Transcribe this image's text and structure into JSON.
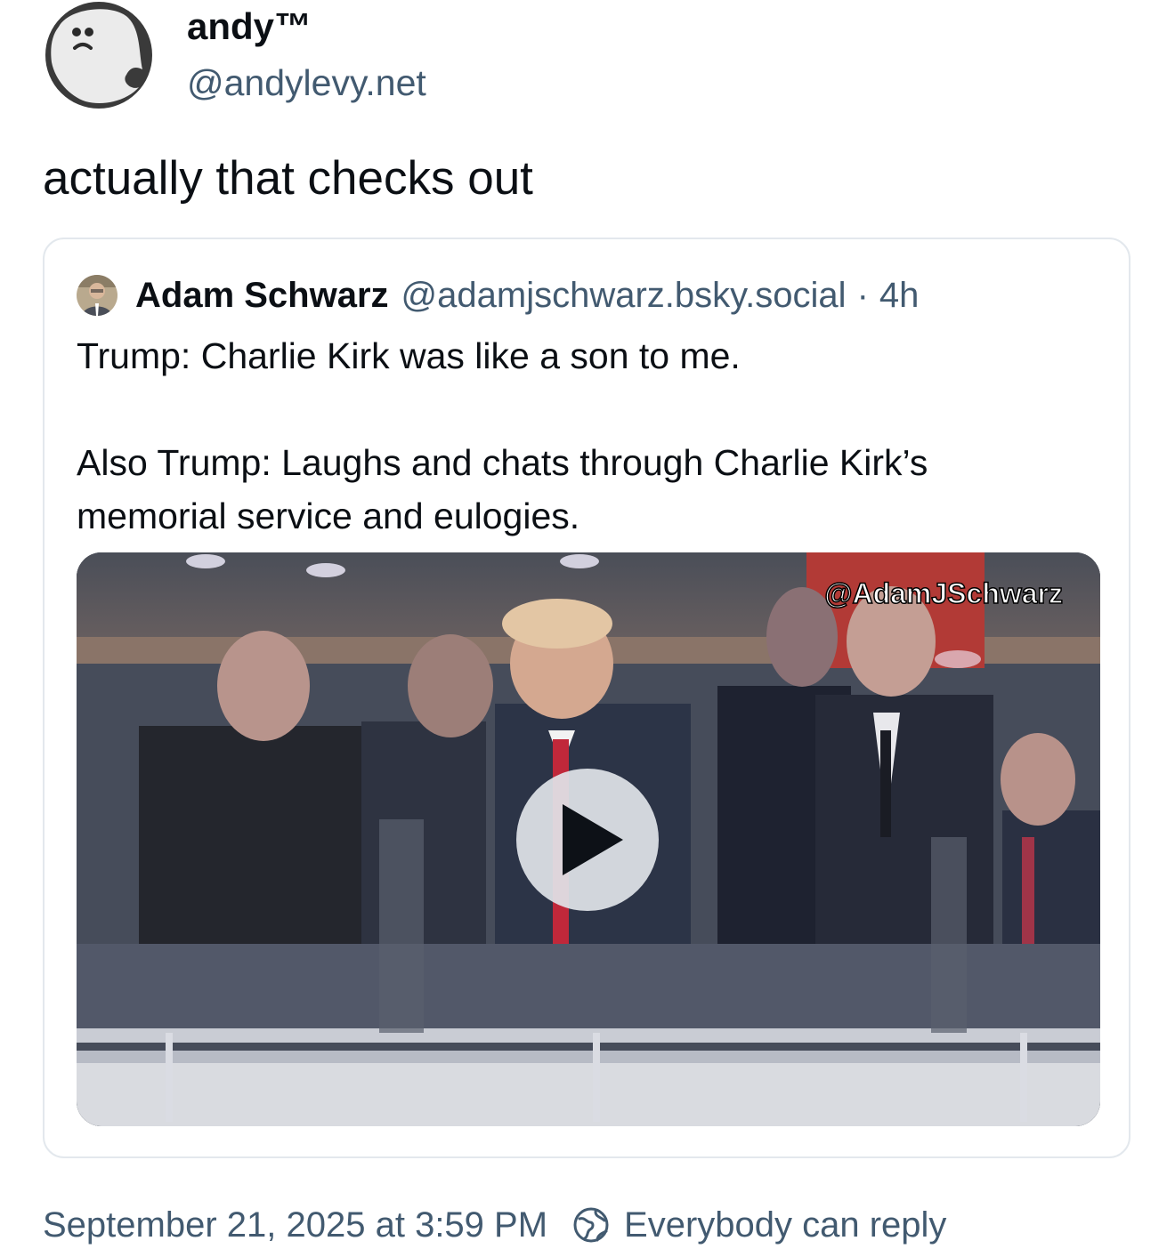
{
  "author": {
    "display_name": "andy™",
    "handle": "@andylevy.net",
    "avatar_icon": "sad-ghost-avatar-icon"
  },
  "post": {
    "text": "actually that checks out"
  },
  "quote": {
    "author_name": "Adam Schwarz",
    "author_handle": "@adamjschwarz.bsky.social",
    "separator": "·",
    "time": "4h",
    "lines": [
      "Trump: Charlie Kirk was like a son to me.",
      "Also Trump: Laughs and chats through Charlie Kirk’s",
      "memorial service and eulogies."
    ],
    "video": {
      "watermark": "@AdamJSchwarz",
      "play_icon": "play-icon"
    }
  },
  "footer": {
    "timestamp": "September 21, 2025 at 3:59 PM",
    "reply_icon": "globe-icon",
    "reply_setting": "Everybody can reply"
  },
  "colors": {
    "text_primary": "#0b0f14",
    "text_secondary": "#425a70",
    "border": "#e3e8ed"
  }
}
